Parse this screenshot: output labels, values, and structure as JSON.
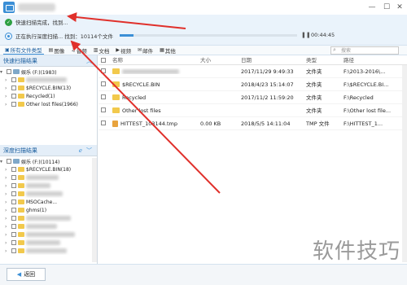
{
  "window": {
    "minimize_glyph": "—",
    "maximize_glyph": "☐",
    "close_glyph": "✕"
  },
  "status": {
    "complete_text": "快速扫描完成，找到...",
    "complete_faded_text": "",
    "running_text": "正在执行深度扫描... 找到：10114个文件",
    "progress_fraction": 0.08,
    "pause_glyph": "❚❚",
    "elapsed": "00:44:45"
  },
  "tabs": [
    {
      "icon": "▣",
      "label": "所有文件类型",
      "active": true
    },
    {
      "icon": "▤",
      "label": "图像"
    },
    {
      "icon": "♫",
      "label": "音频"
    },
    {
      "icon": "▥",
      "label": "文档"
    },
    {
      "icon": "▶",
      "label": "视频"
    },
    {
      "icon": "✉",
      "label": "邮件"
    },
    {
      "icon": "▦",
      "label": "其他"
    }
  ],
  "search_placeholder": "搜索",
  "quick_scan": {
    "title": "快速扫描结果",
    "drive": "娱乐 (F:)(1983)",
    "items": [
      "",
      "$RECYCLE.BIN(13)",
      "Recycled(1)",
      "Other lost files(1966)"
    ]
  },
  "deep_scan": {
    "title": "深度扫描结果",
    "drive": "娱乐 (F:)(10114)",
    "items": [
      "$RECYCLE.BIN(18)",
      "",
      "",
      "",
      "MSOCache...",
      "ghms(1)",
      "",
      "",
      "",
      "",
      "",
      ""
    ]
  },
  "columns": [
    "名称",
    "大小",
    "日期",
    "类型",
    "路径"
  ],
  "files": [
    {
      "name": "",
      "size": "",
      "date": "2017/11/29 9:49:33",
      "type": "文件夹",
      "path": "F:\\2013-2016\\...",
      "blur": true
    },
    {
      "name": "$RECYCLE.BIN",
      "size": "",
      "date": "2018/4/23 15:14:07",
      "type": "文件夹",
      "path": "F:\\$RECYCLE.BI..."
    },
    {
      "name": "Recycled",
      "size": "",
      "date": "2017/11/2 11:59:20",
      "type": "文件夹",
      "path": "F:\\Recycled"
    },
    {
      "name": "Other lost files",
      "size": "",
      "date": "",
      "type": "文件夹",
      "path": "F:\\Other lost file..."
    },
    {
      "name": "HITTEST_103144.tmp",
      "size": "0.00 KB",
      "date": "2018/5/5 14:11:04",
      "type": "TMP 文件",
      "path": "F:\\HITTEST_1..."
    }
  ],
  "back_label": "返回",
  "watermark": "软件技巧"
}
